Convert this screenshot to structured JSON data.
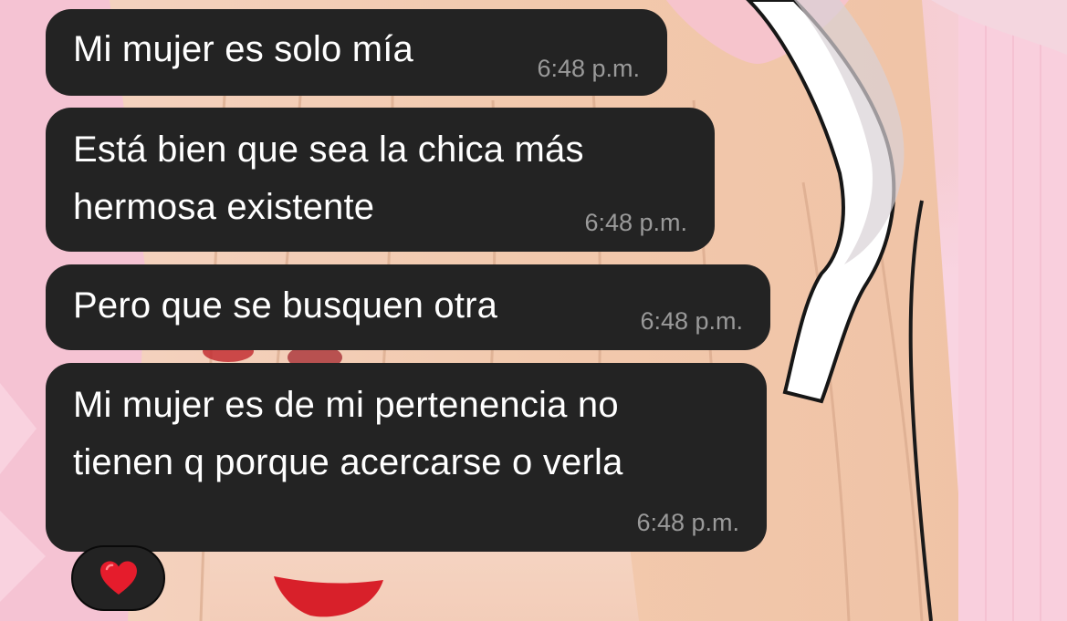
{
  "conversation": {
    "messages": [
      {
        "text": "Mi mujer es solo mía",
        "time": "6:48 p.m."
      },
      {
        "text": "Está bien que sea la chica más\nhermosa existente",
        "time": "6:48 p.m."
      },
      {
        "text": "Pero que se busquen otra",
        "time": "6:48 p.m."
      },
      {
        "text": "Mi mujer es de mi pertenencia no\ntienen q porque acercarse o verla",
        "time": "6:48 p.m."
      }
    ],
    "reaction": {
      "icon": "red-heart-icon",
      "color": "#e51c2c"
    }
  },
  "theme": {
    "bubble_color": "#232323",
    "text_color": "#ffffff",
    "time_color": "#9a9a9a"
  }
}
